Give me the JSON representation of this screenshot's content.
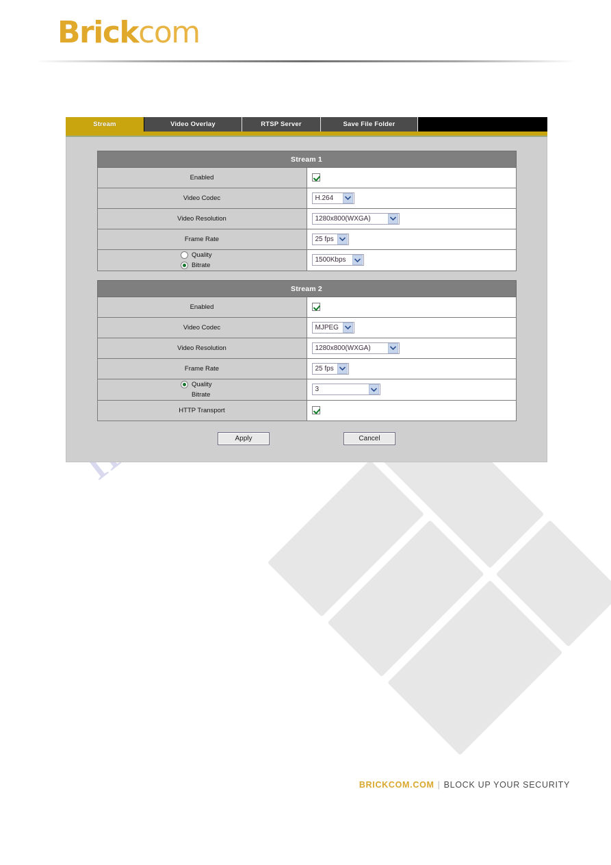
{
  "brand": {
    "logo_bold": "Brick",
    "logo_light": "com"
  },
  "tabs": [
    {
      "label": "Stream",
      "active": true
    },
    {
      "label": "Video Overlay",
      "active": false
    },
    {
      "label": "RTSP Server",
      "active": false
    },
    {
      "label": "Save File Folder",
      "active": false
    }
  ],
  "streams": [
    {
      "title": "Stream 1",
      "rows": {
        "enabled_label": "Enabled",
        "enabled_checked": true,
        "codec_label": "Video Codec",
        "codec_value": "H.264",
        "resolution_label": "Video Resolution",
        "resolution_value": "1280x800(WXGA)",
        "framerate_label": "Frame Rate",
        "framerate_value": "25 fps",
        "quality_label": "Quality",
        "bitrate_label": "Bitrate",
        "quality_selected": false,
        "bitrate_selected": true,
        "rate_value": "1500Kbps"
      }
    },
    {
      "title": "Stream 2",
      "rows": {
        "enabled_label": "Enabled",
        "enabled_checked": true,
        "codec_label": "Video Codec",
        "codec_value": "MJPEG",
        "resolution_label": "Video Resolution",
        "resolution_value": "1280x800(WXGA)",
        "framerate_label": "Frame Rate",
        "framerate_value": "25 fps",
        "quality_label": "Quality",
        "bitrate_label": "Bitrate",
        "quality_selected": true,
        "bitrate_selected": false,
        "rate_value": "3",
        "http_transport_label": "HTTP Transport",
        "http_transport_checked": true
      }
    }
  ],
  "actions": {
    "apply_label": "Apply",
    "cancel_label": "Cancel"
  },
  "watermark": {
    "text": "manualshive.com"
  },
  "footer": {
    "site": "BRICKCOM.COM",
    "divider": "|",
    "tagline": "BLOCK UP YOUR SECURITY"
  },
  "colors": {
    "brand_gold": "#e0a92b",
    "tab_active": "#c9a50f",
    "tab_inactive": "#4b4b4b",
    "section_header": "#7f7f7f",
    "panel_bg": "#cfcfcf",
    "check_green": "#0e7a24"
  }
}
